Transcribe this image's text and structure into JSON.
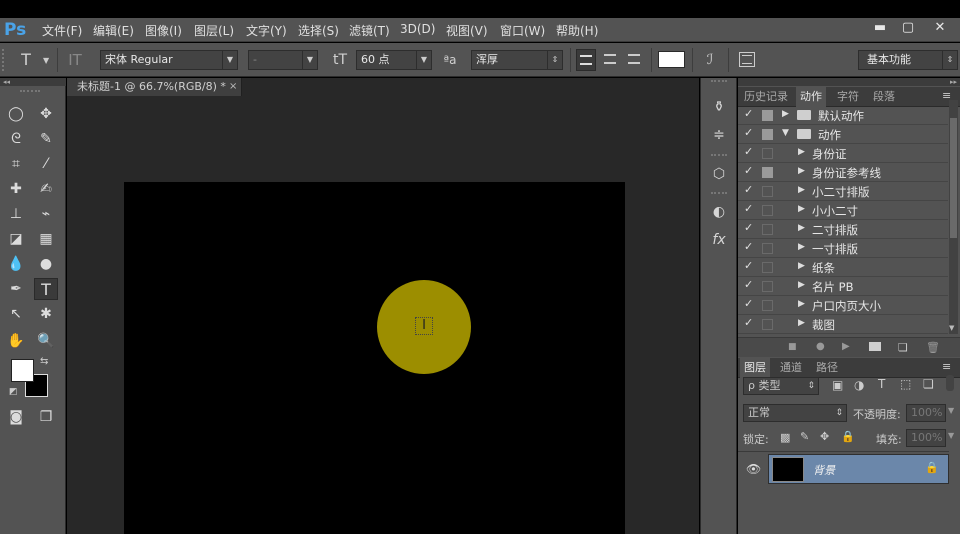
{
  "app": {
    "logo": "Ps"
  },
  "menu": [
    "文件(F)",
    "编辑(E)",
    "图像(I)",
    "图层(L)",
    "文字(Y)",
    "选择(S)",
    "滤镜(T)",
    "3D(D)",
    "视图(V)",
    "窗口(W)",
    "帮助(H)"
  ],
  "window_controls": {
    "minimize": "▬",
    "maximize": "▢",
    "close": "✕"
  },
  "options": {
    "tool_glyph": "T",
    "font_family": "宋体 Regular",
    "font_style": "-",
    "font_size": "60 点",
    "aa_label": "ªa",
    "antialias": "浑厚",
    "color": "#ffffff",
    "workspace": "基本功能"
  },
  "document": {
    "tab_title": "未标题-1 @ 66.7%(RGB/8) *",
    "close": "×",
    "canvas_color": "#000000",
    "circle_color": "#9c8e00"
  },
  "colors": {
    "foreground": "#ffffff",
    "background": "#000000"
  },
  "actions_panel": {
    "tabs": [
      "历史记录",
      "动作",
      "字符",
      "段落"
    ],
    "active_tab": "动作",
    "items": [
      {
        "label": "默认动作",
        "level": 0,
        "type": "set",
        "expanded": false,
        "dialog": true
      },
      {
        "label": "动作",
        "level": 0,
        "type": "set",
        "expanded": true,
        "dialog": true
      },
      {
        "label": "身份证",
        "level": 1,
        "type": "action",
        "dialog": false
      },
      {
        "label": "身份证参考线",
        "level": 1,
        "type": "action",
        "dialog": true
      },
      {
        "label": "小二寸排版",
        "level": 1,
        "type": "action",
        "dialog": false
      },
      {
        "label": "小小二寸",
        "level": 1,
        "type": "action",
        "dialog": false
      },
      {
        "label": "二寸排版",
        "level": 1,
        "type": "action",
        "dialog": false
      },
      {
        "label": "一寸排版",
        "level": 1,
        "type": "action",
        "dialog": false
      },
      {
        "label": "纸条",
        "level": 1,
        "type": "action",
        "dialog": false
      },
      {
        "label": "名片 PB",
        "level": 1,
        "type": "action",
        "dialog": false
      },
      {
        "label": "户口内页大小",
        "level": 1,
        "type": "action",
        "dialog": false
      },
      {
        "label": "裁图",
        "level": 1,
        "type": "action",
        "dialog": false
      }
    ]
  },
  "layers_panel": {
    "tabs": [
      "图层",
      "通道",
      "路径"
    ],
    "active_tab": "图层",
    "filter": "ρ 类型",
    "blend_mode": "正常",
    "opacity_label": "不透明度:",
    "opacity_value": "100%",
    "lock_label": "锁定:",
    "fill_label": "填充:",
    "fill_value": "100%",
    "layers": [
      {
        "name": "背景",
        "visible": true,
        "locked": true
      }
    ]
  }
}
